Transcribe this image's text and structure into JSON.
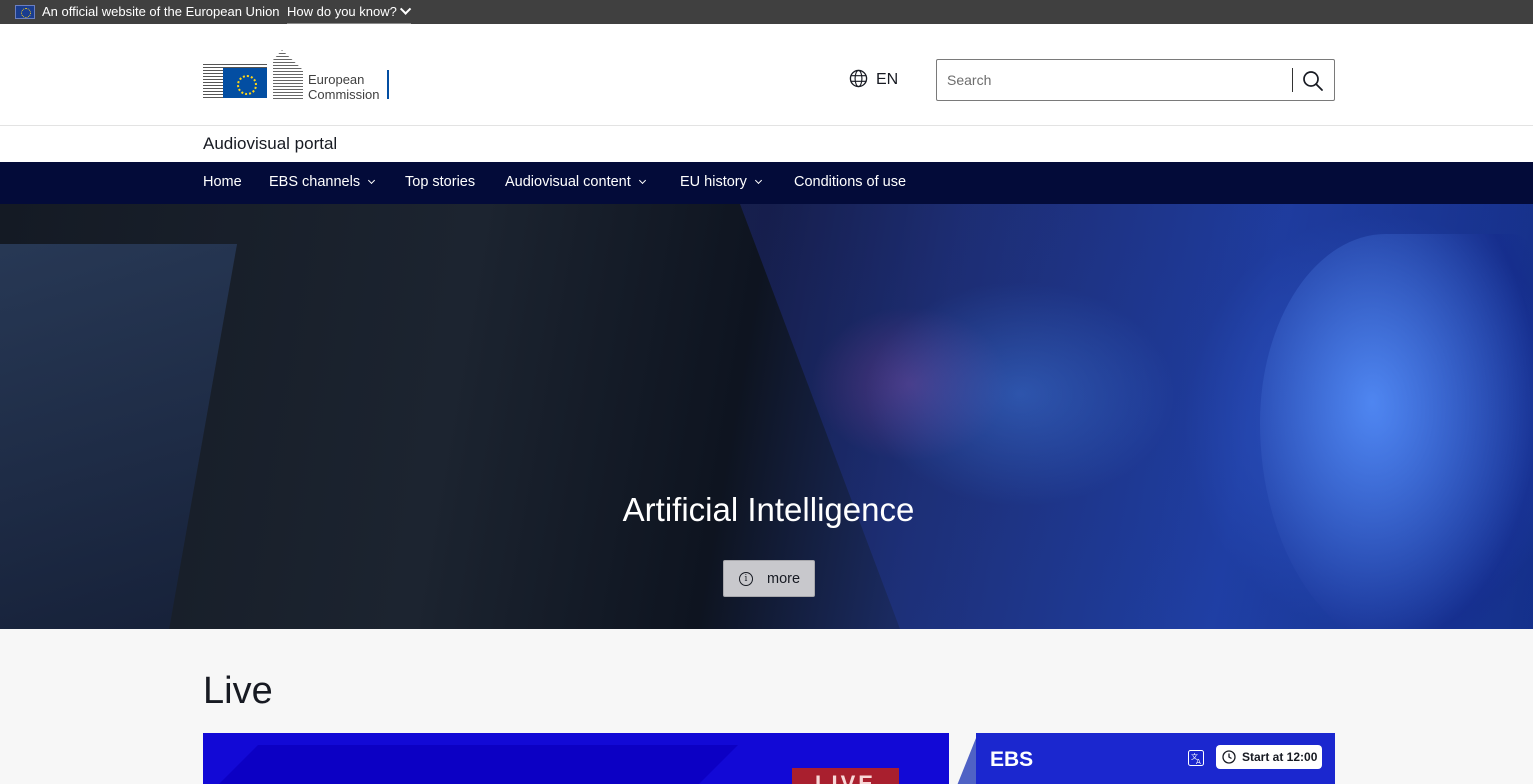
{
  "eu_bar": {
    "official_text": "An official website of the European Union",
    "how_label": "How do you know?"
  },
  "header": {
    "logo_line1": "European",
    "logo_line2": "Commission",
    "language": "EN",
    "search_placeholder": "Search"
  },
  "site_name": "Audiovisual portal",
  "nav": {
    "items": [
      {
        "label": "Home",
        "dropdown": false
      },
      {
        "label": "EBS channels",
        "dropdown": true
      },
      {
        "label": "Top stories",
        "dropdown": false
      },
      {
        "label": "Audiovisual content",
        "dropdown": true
      },
      {
        "label": "EU history",
        "dropdown": true
      },
      {
        "label": "Conditions of use",
        "dropdown": false
      }
    ]
  },
  "hero": {
    "title": "Artificial Intelligence",
    "more_label": "more",
    "more_icon": "info-icon"
  },
  "live": {
    "title": "Live",
    "player_badge": "LIVE",
    "channel_name": "EBS",
    "start_label": "Start at 12:00"
  },
  "colors": {
    "eu_bar_bg": "#404040",
    "nav_bg": "#030b39",
    "accent_blue": "#034ea2",
    "live_red": "#a91f2e",
    "ebs_blue": "#1b27cf"
  }
}
